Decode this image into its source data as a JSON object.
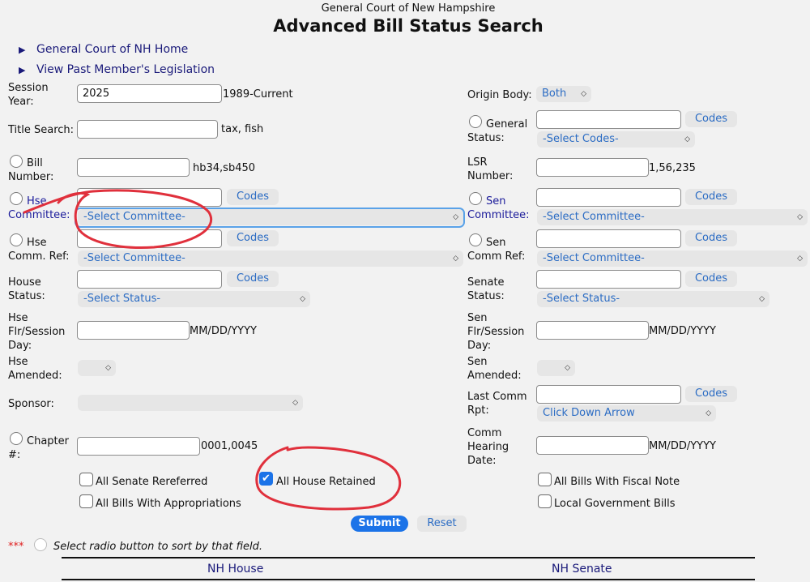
{
  "header": {
    "subtitle": "General Court of New Hampshire",
    "title": "Advanced Bill Status Search"
  },
  "nav": {
    "home": "General Court of NH Home",
    "past": "View Past Member's Legislation"
  },
  "left": {
    "session_label_1": "Session",
    "session_label_2": "Year:",
    "session_value": "2025",
    "session_hint": "1989-Current",
    "title_label": "Title Search:",
    "title_hint": "tax, fish",
    "bill_label_1": "Bill",
    "bill_label_2": "Number:",
    "bill_hint": "hb34,sb450",
    "hse_comm_label_1": "Hse",
    "hse_comm_label_2": "Committee:",
    "hse_comm_select": "-Select Committee-",
    "hse_ref_label_1": "Hse",
    "hse_ref_label_2": "Comm. Ref:",
    "hse_ref_select": "-Select Committee-",
    "house_status_label_1": "House",
    "house_status_label_2": "Status:",
    "house_status_select": "-Select Status-",
    "hse_flr_label_1": "Hse",
    "hse_flr_label_2": "Flr/Session",
    "hse_flr_label_3": "Day:",
    "hse_flr_hint": "MM/DD/YYYY",
    "hse_amend_label_1": "Hse",
    "hse_amend_label_2": "Amended:",
    "sponsor_label": "Sponsor:",
    "chapter_label_1": "Chapter",
    "chapter_label_2": "#:",
    "chapter_hint": "0001,0045"
  },
  "right": {
    "origin_label": "Origin Body:",
    "origin_select": "Both",
    "general_label_1": "General",
    "general_label_2": "Status:",
    "general_select": "-Select Codes-",
    "lsr_label_1": "LSR",
    "lsr_label_2": "Number:",
    "lsr_hint": "1,56,235",
    "sen_comm_label_1": "Sen",
    "sen_comm_label_2": "Committee:",
    "sen_comm_select": "-Select Committee-",
    "sen_ref_label_1": "Sen",
    "sen_ref_label_2": "Comm Ref:",
    "sen_ref_select": "-Select Committee-",
    "senate_status_label_1": "Senate",
    "senate_status_label_2": "Status:",
    "senate_status_select": "-Select Status-",
    "sen_flr_label_1": "Sen",
    "sen_flr_label_2": "Flr/Session",
    "sen_flr_label_3": "Day:",
    "sen_flr_hint": "MM/DD/YYYY",
    "sen_amend_label_1": "Sen",
    "sen_amend_label_2": "Amended:",
    "last_comm_label_1": "Last Comm",
    "last_comm_label_2": "Rpt:",
    "last_comm_select": "Click Down Arrow",
    "hearing_label_1": "Comm",
    "hearing_label_2": "Hearing",
    "hearing_label_3": "Date:",
    "hearing_hint": "MM/DD/YYYY"
  },
  "codes_label": "Codes",
  "checks": {
    "senate_rereferred": "All Senate Rereferred",
    "appropriations": "All Bills With Appropriations",
    "house_retained": "All House Retained",
    "house_retained_checked": true,
    "fiscal_note": "All Bills With Fiscal Note",
    "local_gov": "Local Government Bills"
  },
  "actions": {
    "submit": "Submit",
    "reset": "Reset"
  },
  "footer": {
    "stars": "***",
    "note": "Select radio button to sort by that field.",
    "house": "NH House",
    "senate": "NH Senate"
  },
  "colors": {
    "accent": "#1b73e8",
    "link": "#1a1a7a",
    "annotation": "#e0303c"
  }
}
